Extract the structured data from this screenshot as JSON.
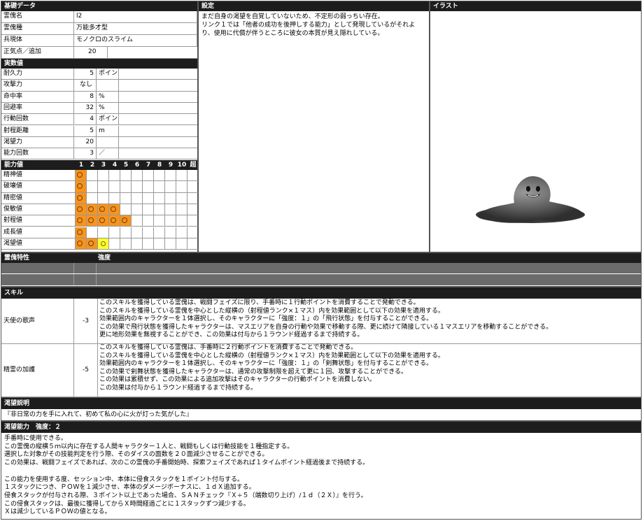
{
  "basic": {
    "title": "基礎データ",
    "rows": [
      {
        "label": "霊傀名",
        "value": "l2"
      },
      {
        "label": "霊傀種",
        "value": "万能多才型"
      },
      {
        "label": "兵現体",
        "value": "モノクロのスライム"
      },
      {
        "label": "正気点／追加",
        "value": "20"
      }
    ]
  },
  "stats": {
    "title": "実数値",
    "rows": [
      {
        "label": "耐久力",
        "value": "5",
        "unit": "ポイント"
      },
      {
        "label": "攻撃力",
        "value": "なし",
        "unit": ""
      },
      {
        "label": "命中率",
        "value": "8",
        "unit": "%"
      },
      {
        "label": "回避率",
        "value": "32",
        "unit": "%"
      },
      {
        "label": "行動回数",
        "value": "4",
        "unit": "ポイント"
      },
      {
        "label": "射程距離",
        "value": "5",
        "unit": "m"
      },
      {
        "label": "渇望力",
        "value": "20",
        "unit": ""
      },
      {
        "label": "能力回数",
        "value": "3",
        "unit": "／"
      }
    ]
  },
  "abilities": {
    "title": "能力値",
    "levels": [
      "1",
      "2",
      "3",
      "4",
      "5",
      "6",
      "7",
      "8",
      "9",
      "10",
      "超"
    ],
    "rows": [
      {
        "label": "精神値",
        "rank": 1
      },
      {
        "label": "破壊値",
        "rank": 1
      },
      {
        "label": "精密値",
        "rank": 1
      },
      {
        "label": "俊敏値",
        "rank": 4
      },
      {
        "label": "射程値",
        "rank": 5
      },
      {
        "label": "成長値",
        "rank": 1
      },
      {
        "label": "渇望値",
        "rank": 3,
        "last_yellow": true
      }
    ]
  },
  "setting": {
    "title": "設定",
    "text": "まだ自身の渇望を自覚していないため、不定形の弱っちい存在。\nリンク１では「他者の成功を後押しする能力」として発現しているがそれより、使用に代償が伴うところに彼女の本質が見え隠れしている。"
  },
  "illust": {
    "title": "イラスト",
    "image_icon": "slime-creature-illustration"
  },
  "traits": {
    "title": "霊傀特性",
    "strength_label": "強度"
  },
  "skills": {
    "title": "スキル",
    "items": [
      {
        "name": "天使の歌声",
        "value": "-3",
        "lines": [
          "このスキルを獲得している霊傀は、戦闘フェイズに限り、手番時に１行動ポイントを消費することで発動できる。",
          "このスキルを獲得している霊傀を中心とした縦横の（射程値ランク×１マス）内を効果範囲として以下の効果を適用する。",
          "効果範囲内のキャラクターを１体選択し、そのキャラクターに「強度：１」の「飛行状態」を付与することができる。",
          "この効果で飛行状態を獲得したキャラクターは、マスエリアを自身の行動や効果で移動する際、更に続けて隣接している１マスエリアを移動することができる。",
          "更に地形効果を無視することができ、この効果は付与から１ラウンド経過するまで持続する。"
        ]
      },
      {
        "name": "精霊の加護",
        "value": "-5",
        "lines": [
          "このスキルを獲得している霊傀は、手番時に２行動ポイントを消費することで発動できる。",
          "このスキルを獲得している霊傀を中心とした縦横の（射程値ランク×１マス）内を効果範囲として以下の効果を適用する。",
          "効果範囲内のキャラクターを１体選択し、そのキャラクターに「強度：１」の「剣舞状態」を付与することができる。",
          "この効果で剣舞状態を獲得したキャラクターは、通常の攻撃制限を超えて更に１回、攻撃することができる。",
          "この効果は累積せず、この効果による追加攻撃はそのキャラクターの行動ポイントを消費しない。",
          "この効果は付与から１ラウンド経過するまで持続する。"
        ]
      }
    ]
  },
  "desire_desc": {
    "title": "渇望説明",
    "text": "『非日常の力を手に入れて、初めて私の心に火が灯った気がした』"
  },
  "desire_power": {
    "title": "渇望能力　強度：２",
    "lines": [
      "手番時に使用できる。",
      "この霊傀の縦横５ｍ以内に存在する人間キャラクター１人と、戦闘もしくは行動技能を１種指定する。",
      "選択した対象がその技能判定を行う際、そのダイスの面数を２０面減少させることができる。",
      "この効果は、戦闘フェイズであれば、次のこの霊傀の手番開始時、探索フェイズであれば１タイムポイント経過後まで持続する。",
      "",
      "この能力を使用する度、セッション中、本体に侵食スタックを１ポイント付与する。",
      "１スタックにつき、ＰＯＷを１減少させ、本体のダメージボーナスに、１ｄＸ追加する。",
      "侵食スタックが付与される際、３ポイント以上であった場合、ＳＡＮチェック『Ｘ÷５（端数切り上げ）/１ｄ（２Ｘ）』を行う。",
      "この侵食スタックは、最後に獲得してからＸ時間経過ごとに１スタックずつ減少する。",
      "Ｘは減少しているＰＯＷの値となる。"
    ]
  }
}
